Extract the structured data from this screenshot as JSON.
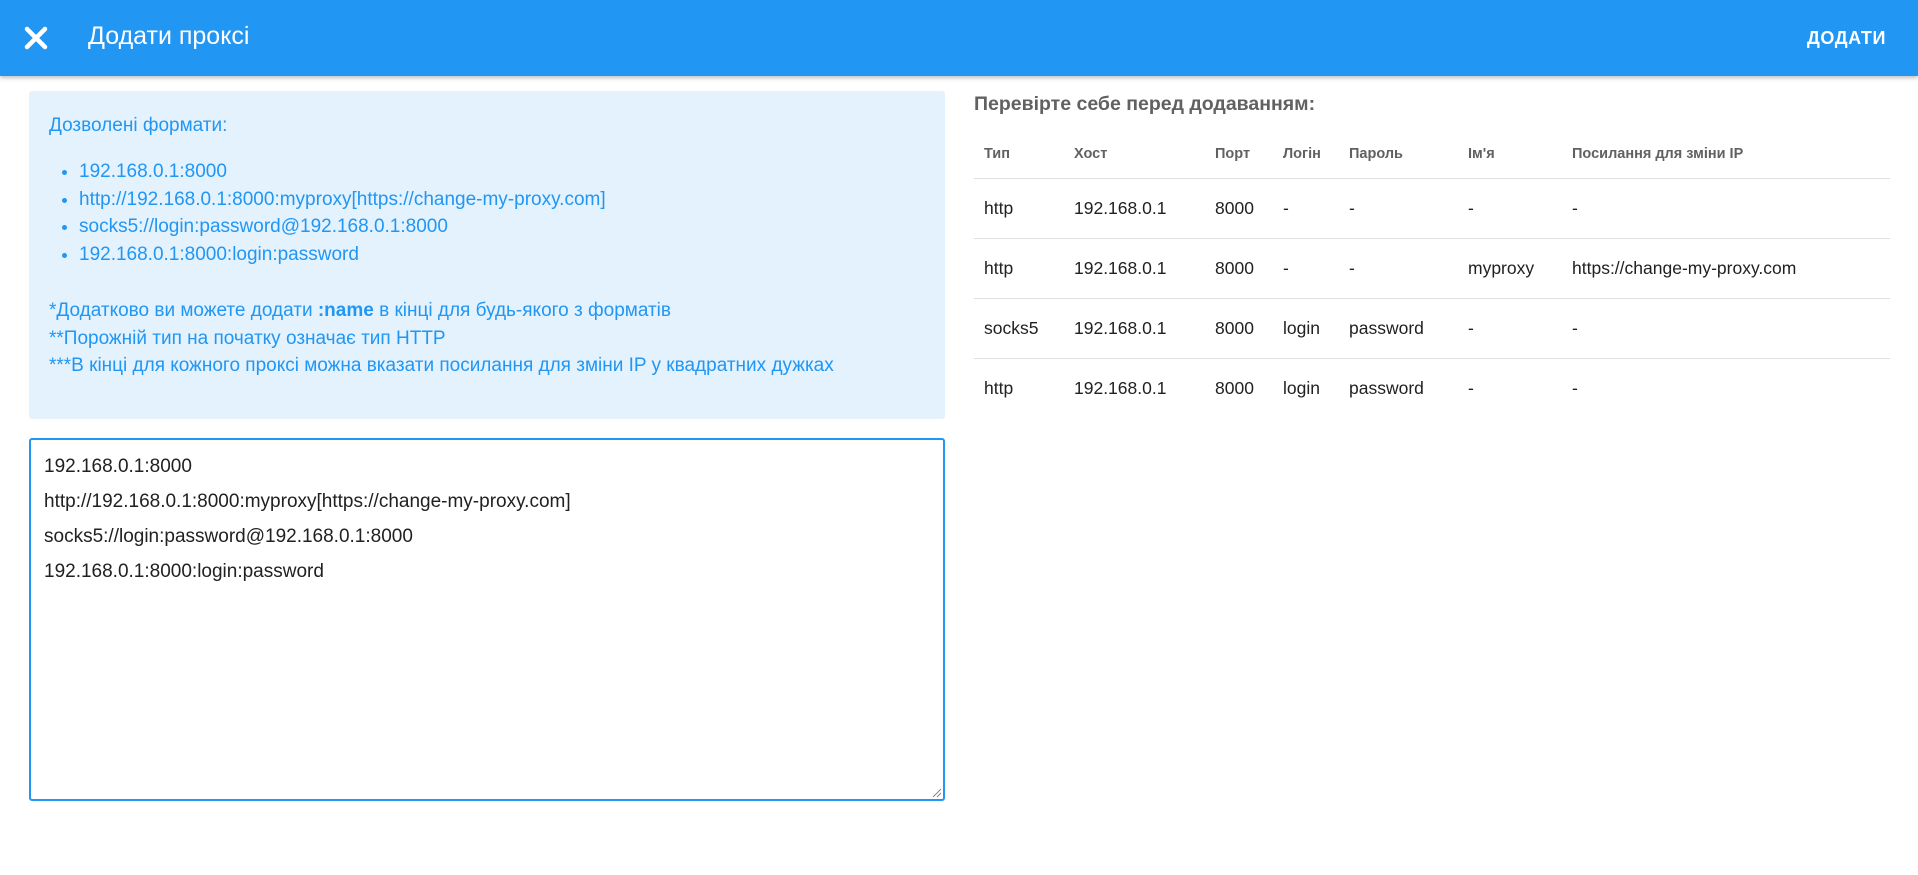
{
  "appbar": {
    "title": "Додати проксі",
    "add_label": "ДОДАТИ",
    "close_icon": "close-icon",
    "color": "#2196f3"
  },
  "info": {
    "heading": "Дозволені формати:",
    "formats": [
      "192.168.0.1:8000",
      "http://192.168.0.1:8000:myproxy[https://change-my-proxy.com]",
      "socks5://login:password@192.168.0.1:8000",
      "192.168.0.1:8000:login:password"
    ],
    "note1_prefix": "*Додатково ви можете додати ",
    "note1_bold": ":name",
    "note1_suffix": " в кінці для будь-якого з форматів",
    "note2": "**Порожній тип на початку означає тип HTTP",
    "note3": "***В кінці для кожного проксі можна вказати посилання для зміни IP у квадратних дужках"
  },
  "input": {
    "lines": [
      "192.168.0.1:8000",
      "http://192.168.0.1:8000:myproxy[https://change-my-proxy.com]",
      "socks5://login:password@192.168.0.1:8000",
      "192.168.0.1:8000:login:password"
    ]
  },
  "preview": {
    "title": "Перевірте себе перед додаванням:",
    "columns": [
      "Тип",
      "Хост",
      "Порт",
      "Логін",
      "Пароль",
      "Ім'я",
      "Посилання для зміни IP"
    ],
    "rows": [
      [
        "http",
        "192.168.0.1",
        "8000",
        "-",
        "-",
        "-",
        "-"
      ],
      [
        "http",
        "192.168.0.1",
        "8000",
        "-",
        "-",
        "myproxy",
        "https://change-my-proxy.com"
      ],
      [
        "socks5",
        "192.168.0.1",
        "8000",
        "login",
        "password",
        "-",
        "-"
      ],
      [
        "http",
        "192.168.0.1",
        "8000",
        "login",
        "password",
        "-",
        "-"
      ]
    ]
  }
}
